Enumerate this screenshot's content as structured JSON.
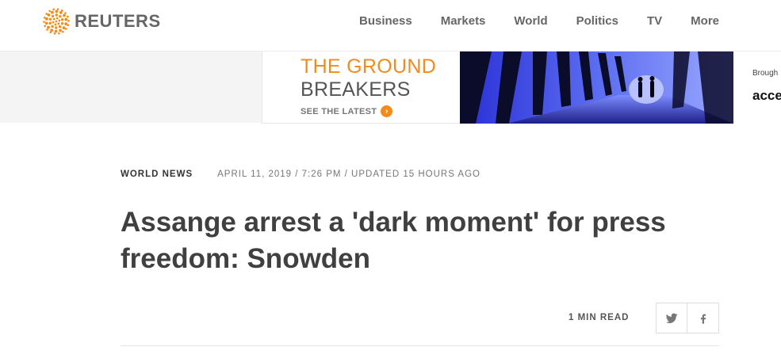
{
  "brand": {
    "name": "REUTERS",
    "accent": "#f28b1c"
  },
  "nav": {
    "items": [
      {
        "label": "Business"
      },
      {
        "label": "Markets"
      },
      {
        "label": "World"
      },
      {
        "label": "Politics"
      },
      {
        "label": "TV"
      },
      {
        "label": "More"
      }
    ]
  },
  "ad": {
    "line1": "THE GROUND",
    "line2": "BREAKERS",
    "cta": "SEE THE LATEST",
    "side_small": "Brough",
    "side_big": "acce"
  },
  "article": {
    "section": "WORLD NEWS",
    "dateline": "APRIL 11, 2019 / 7:26 PM / UPDATED 15 HOURS AGO",
    "headline": "Assange arrest a 'dark moment' for press freedom: Snowden",
    "read_time": "1 MIN READ"
  },
  "share": {
    "twitter_icon": "twitter-icon",
    "facebook_icon": "facebook-icon"
  }
}
